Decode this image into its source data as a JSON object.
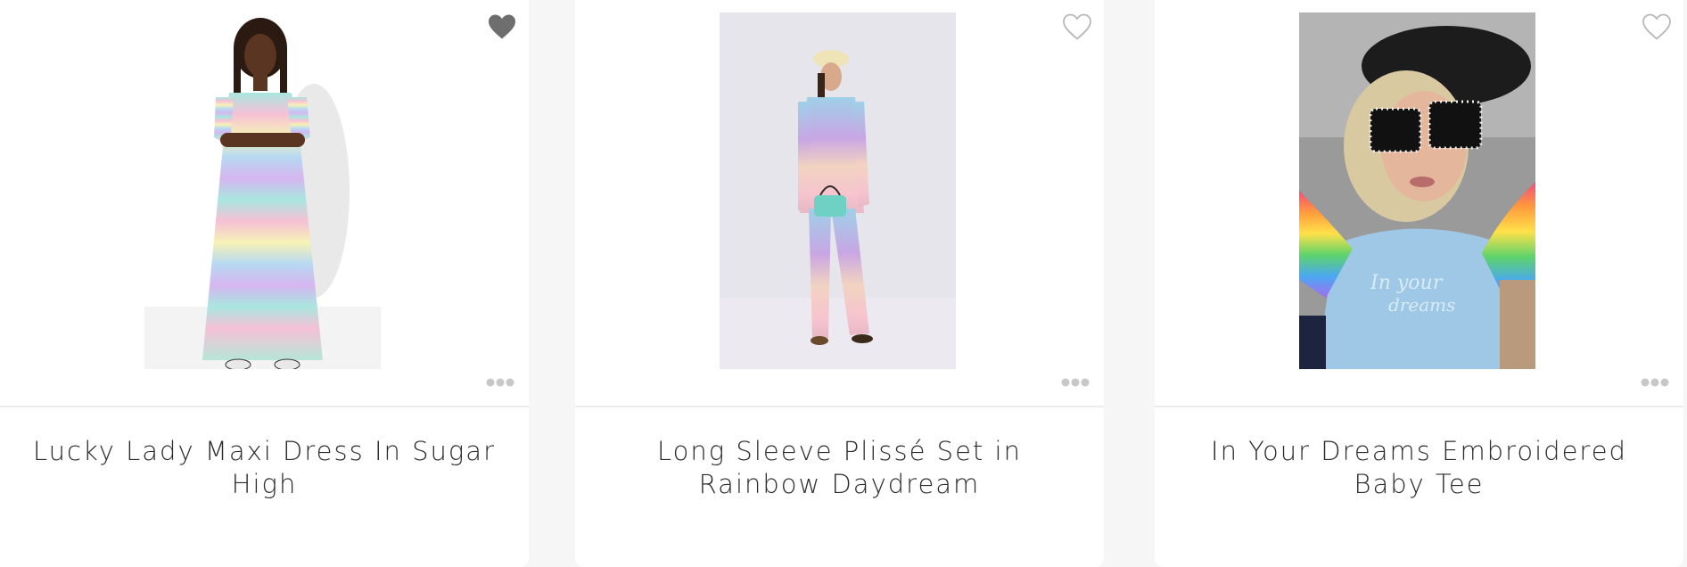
{
  "products": [
    {
      "title": "Lucky Lady Maxi Dress In Sugar High",
      "favorited": true,
      "favorite_icon": "heart-filled-icon",
      "more_icon": "more-dots-icon",
      "image_desc": "photo-maxi-dress"
    },
    {
      "title": "Long Sleeve Plissé Set in Rainbow Daydream",
      "favorited": false,
      "favorite_icon": "heart-outline-icon",
      "more_icon": "more-dots-icon",
      "image_desc": "photo-plisse-set"
    },
    {
      "title": "In Your Dreams Embroidered Baby Tee",
      "favorited": false,
      "favorite_icon": "heart-outline-icon",
      "more_icon": "more-dots-icon",
      "image_desc": "photo-baby-tee"
    }
  ],
  "colors": {
    "page_bg": "#f6f6f6",
    "card_bg": "#ffffff",
    "text": "#2b2b2b",
    "icon_gray": "#6e6e6e",
    "icon_light": "#c8c8c8"
  }
}
